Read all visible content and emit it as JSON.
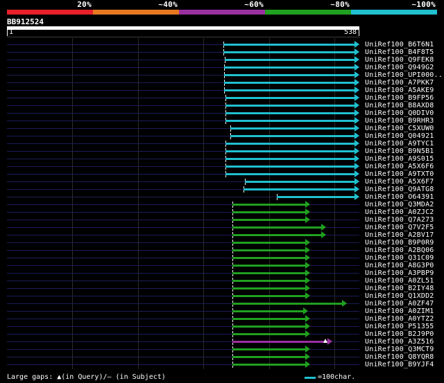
{
  "legend": {
    "segments": [
      {
        "label": "20%",
        "color": "#e8202a"
      },
      {
        "label": "~40%",
        "color": "#e87820"
      },
      {
        "label": "~60%",
        "color": "#9a30a0"
      },
      {
        "label": "~80%",
        "color": "#20a020"
      },
      {
        "label": "~100%",
        "color": "#20c0d0"
      }
    ]
  },
  "query": {
    "id": "BB912524",
    "start": "1",
    "end": "538",
    "length": 538
  },
  "hits": [
    {
      "label": "UniRef100_B6T6N1",
      "color": "cyan",
      "start": 330,
      "end": 538
    },
    {
      "label": "UniRef100_B4F8T5",
      "color": "cyan",
      "start": 330,
      "end": 538
    },
    {
      "label": "UniRef100_Q9FEK8",
      "color": "cyan",
      "start": 333,
      "end": 538
    },
    {
      "label": "UniRef100_Q949G2",
      "color": "cyan",
      "start": 331,
      "end": 538
    },
    {
      "label": "UniRef100_UPI000..",
      "color": "cyan",
      "start": 331,
      "end": 538
    },
    {
      "label": "UniRef100_A7PKK7",
      "color": "cyan",
      "start": 331,
      "end": 538
    },
    {
      "label": "UniRef100_A5AKE9",
      "color": "cyan",
      "start": 331,
      "end": 538
    },
    {
      "label": "UniRef100_B9FP56",
      "color": "cyan",
      "start": 334,
      "end": 538
    },
    {
      "label": "UniRef100_B8AXD8",
      "color": "cyan",
      "start": 334,
      "end": 538
    },
    {
      "label": "UniRef100_Q0DIV0",
      "color": "cyan",
      "start": 334,
      "end": 538
    },
    {
      "label": "UniRef100_B9RHR3",
      "color": "cyan",
      "start": 334,
      "end": 538
    },
    {
      "label": "UniRef100_C5XUW0",
      "color": "cyan",
      "start": 341,
      "end": 538
    },
    {
      "label": "UniRef100_Q04921",
      "color": "cyan",
      "start": 341,
      "end": 538
    },
    {
      "label": "UniRef100_A9TYC1",
      "color": "cyan",
      "start": 334,
      "end": 538
    },
    {
      "label": "UniRef100_B9N5B1",
      "color": "cyan",
      "start": 334,
      "end": 538
    },
    {
      "label": "UniRef100_A9S015",
      "color": "cyan",
      "start": 334,
      "end": 538
    },
    {
      "label": "UniRef100_A5X6F6",
      "color": "cyan",
      "start": 334,
      "end": 538
    },
    {
      "label": "UniRef100_A9TXT0",
      "color": "cyan",
      "start": 334,
      "end": 538
    },
    {
      "label": "UniRef100_A5X6F7",
      "color": "cyan",
      "start": 363,
      "end": 538
    },
    {
      "label": "UniRef100_Q9ATG8",
      "color": "cyan",
      "start": 361,
      "end": 538
    },
    {
      "label": "UniRef100_O64391",
      "color": "cyan",
      "start": 412,
      "end": 538
    },
    {
      "label": "UniRef100_Q3MDA2",
      "color": "green",
      "start": 344,
      "end": 463
    },
    {
      "label": "UniRef100_A0ZJC2",
      "color": "green",
      "start": 344,
      "end": 463
    },
    {
      "label": "UniRef100_Q7A273",
      "color": "green",
      "start": 344,
      "end": 463
    },
    {
      "label": "UniRef100_Q7V2F5",
      "color": "green",
      "start": 344,
      "end": 487
    },
    {
      "label": "UniRef100_A2BV17",
      "color": "green",
      "start": 344,
      "end": 487
    },
    {
      "label": "UniRef100_B9P0R9",
      "color": "green",
      "start": 344,
      "end": 463
    },
    {
      "label": "UniRef100_A2BQ06",
      "color": "green",
      "start": 344,
      "end": 463
    },
    {
      "label": "UniRef100_Q31C09",
      "color": "green",
      "start": 344,
      "end": 463
    },
    {
      "label": "UniRef100_A8G3P0",
      "color": "green",
      "start": 344,
      "end": 463
    },
    {
      "label": "UniRef100_A3PBP9",
      "color": "green",
      "start": 344,
      "end": 463
    },
    {
      "label": "UniRef100_A0ZL51",
      "color": "green",
      "start": 344,
      "end": 463
    },
    {
      "label": "UniRef100_B2IY48",
      "color": "green",
      "start": 344,
      "end": 463
    },
    {
      "label": "UniRef100_Q1XDD2",
      "color": "green",
      "start": 344,
      "end": 463
    },
    {
      "label": "UniRef100_A0ZF47",
      "color": "green",
      "start": 344,
      "end": 519
    },
    {
      "label": "UniRef100_A0ZIM1",
      "color": "green",
      "start": 344,
      "end": 460
    },
    {
      "label": "UniRef100_A0YTZ2",
      "color": "green",
      "start": 344,
      "end": 463
    },
    {
      "label": "UniRef100_P51355",
      "color": "green",
      "start": 344,
      "end": 463
    },
    {
      "label": "UniRef100_B2J9P0",
      "color": "green",
      "start": 344,
      "end": 463
    },
    {
      "label": "UniRef100_A3Z516",
      "color": "purple",
      "start": 344,
      "end": 497,
      "gap": true
    },
    {
      "label": "UniRef100_Q3MCT9",
      "color": "green",
      "start": 344,
      "end": 463
    },
    {
      "label": "UniRef100_Q8YQR8",
      "color": "green",
      "start": 344,
      "end": 463
    },
    {
      "label": "UniRef100_B9YJF4",
      "color": "green",
      "start": 344,
      "end": 463
    }
  ],
  "colors": {
    "cyan": "#20c0d0",
    "green": "#20a020",
    "purple": "#9a30a0",
    "track": "#1c1c5a"
  },
  "footer": {
    "gaps_text": "Large gaps: ▲(in Query)/– (in Subject)",
    "scale_text": "=100char."
  }
}
